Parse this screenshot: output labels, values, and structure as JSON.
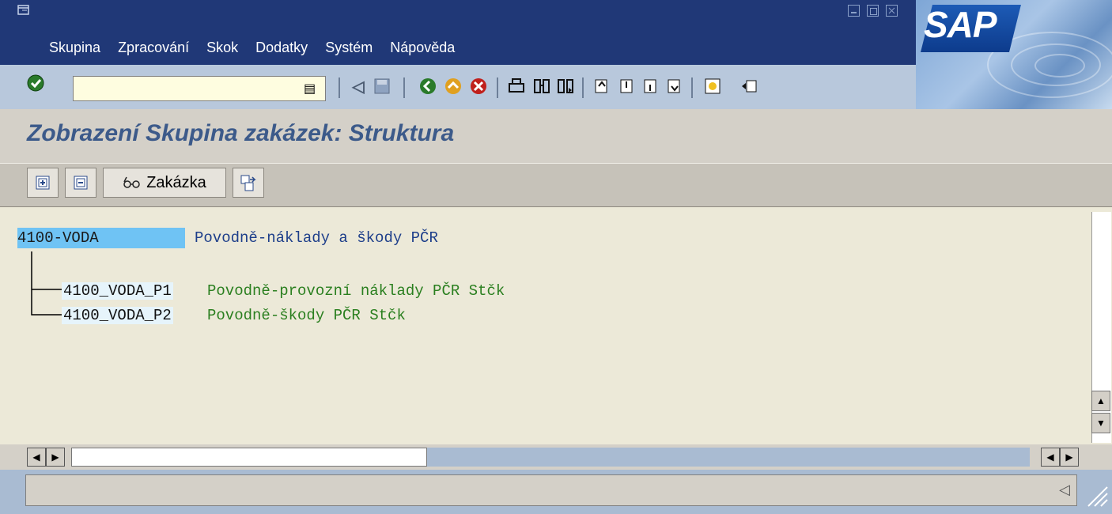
{
  "menu": {
    "items": [
      "Skupina",
      "Zpracování",
      "Skok",
      "Dodatky",
      "Systém",
      "Nápověda"
    ]
  },
  "logo": {
    "text": "SAP"
  },
  "toolbar": {
    "enter_icon": "checkmark-icon",
    "command_value": "",
    "command_icon": "dropdown-history-icon",
    "icons": [
      "back-arrow-icon",
      "save-icon",
      "back-icon",
      "exit-icon",
      "cancel-icon",
      "print-icon",
      "find-icon",
      "find-next-icon",
      "first-page-icon",
      "previous-page-icon",
      "next-page-icon",
      "last-page-icon",
      "create-session-icon",
      "shortcut-icon"
    ]
  },
  "page": {
    "title": "Zobrazení Skupina zakázek: Struktura"
  },
  "app_toolbar": {
    "expand_icon": "expand-all-icon",
    "collapse_icon": "collapse-all-icon",
    "order_button_label": "Zakázka",
    "order_button_icon": "glasses-icon",
    "export_icon": "export-icon"
  },
  "tree": {
    "root": {
      "code": "4100-VODA",
      "description": "Povodně-náklady a škody PČR"
    },
    "children": [
      {
        "code": "4100_VODA_P1",
        "description": "Povodně-provozní náklady PČR Stčk"
      },
      {
        "code": "4100_VODA_P2",
        "description": "Povodně-škody PČR Stčk"
      }
    ]
  },
  "colors": {
    "titlebar": "#203877",
    "root_highlight": "#6fc3f4",
    "root_text": "#1d3e8a",
    "child_text": "#2a7f1f"
  },
  "status": {
    "text": ""
  }
}
